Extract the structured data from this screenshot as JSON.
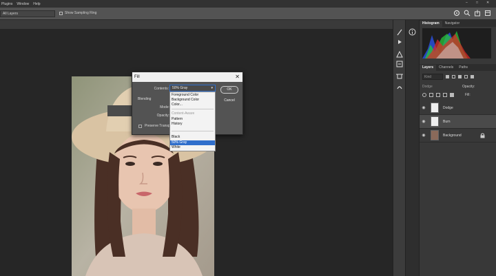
{
  "menubar": {
    "items": [
      "Plugins",
      "Window",
      "Help"
    ],
    "minimize": "–",
    "restore": "□",
    "close": "✕"
  },
  "options_bar": {
    "layers_select": "All Layers",
    "sampling_ring": "Show Sampling Ring",
    "icons": [
      "cloud-icon",
      "search-icon",
      "share-icon",
      "view-icon"
    ]
  },
  "fill_dialog": {
    "title": "Fill",
    "contents_label": "Contents:",
    "contents_value": "50% Gray",
    "blending_label": "Blending",
    "mode_label": "Mode:",
    "opacity_label": "Opacity:",
    "preserve_label": "Preserve Transparency",
    "ok": "OK",
    "cancel": "Cancel",
    "options": [
      {
        "label": "Foreground Color",
        "state": "normal"
      },
      {
        "label": "Background Color",
        "state": "normal"
      },
      {
        "label": "Color...",
        "state": "normal"
      },
      {
        "label": "Content-Aware",
        "state": "dim"
      },
      {
        "label": "Pattern",
        "state": "normal"
      },
      {
        "label": "History",
        "state": "normal"
      },
      {
        "label": "Black",
        "state": "normal"
      },
      {
        "label": "50% Gray",
        "state": "selected"
      },
      {
        "label": "White",
        "state": "normal"
      }
    ]
  },
  "right_panel": {
    "top_tabs": [
      "Histogram",
      "Navigator"
    ],
    "layer_tabs": [
      "Layers",
      "Channels",
      "Paths"
    ],
    "kind_placeholder": "Kind",
    "blend_mode": "Dodge",
    "opacity_label": "Opacity:",
    "fill_label": "Fill:",
    "layers": [
      {
        "name": "Dodge",
        "thumb": "white"
      },
      {
        "name": "Burn",
        "thumb": "white"
      },
      {
        "name": "Background",
        "thumb": "photo"
      }
    ]
  },
  "colors": {
    "selection": "#2f6ecb",
    "panel_bg": "#383838",
    "dialog_bg": "#535353"
  }
}
